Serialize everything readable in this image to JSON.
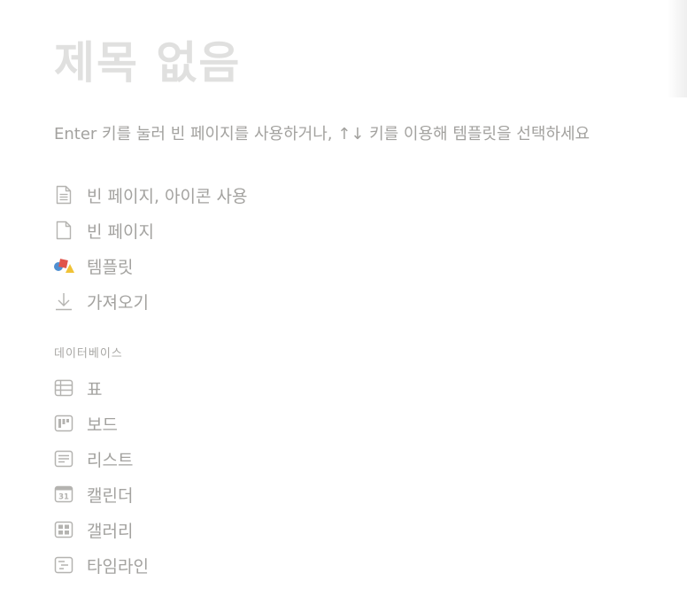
{
  "page": {
    "title": "제목 없음",
    "hint": "Enter 키를 눌러 빈 페이지를 사용하거나, ↑↓ 키를 이용해 템플릿을 선택하세요"
  },
  "menu": {
    "items": [
      {
        "label": "빈 페이지, 아이콘 사용",
        "icon": "document-text-icon"
      },
      {
        "label": "빈 페이지",
        "icon": "document-icon"
      },
      {
        "label": "템플릿",
        "icon": "template-shapes-icon"
      },
      {
        "label": "가져오기",
        "icon": "download-arrow-icon"
      }
    ]
  },
  "database": {
    "header": "데이터베이스",
    "items": [
      {
        "label": "표",
        "icon": "table-icon"
      },
      {
        "label": "보드",
        "icon": "board-icon"
      },
      {
        "label": "리스트",
        "icon": "list-icon"
      },
      {
        "label": "캘린더",
        "icon": "calendar-icon",
        "icon_text": "31"
      },
      {
        "label": "갤러리",
        "icon": "gallery-icon"
      },
      {
        "label": "타임라인",
        "icon": "timeline-icon"
      }
    ]
  },
  "colors": {
    "title": "#e0e0df",
    "text": "#a3a29f",
    "icon": "#b4b3b0",
    "template_red": "#e0544b",
    "template_blue": "#4f8fd1",
    "template_yellow": "#f0c236"
  }
}
